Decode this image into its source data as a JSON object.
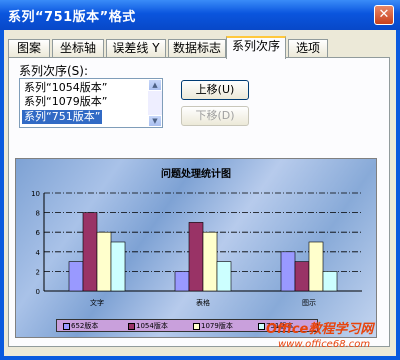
{
  "window": {
    "title": "系列“751版本”格式",
    "close_symbol": "✕"
  },
  "tabs": [
    {
      "label": "图案"
    },
    {
      "label": "坐标轴"
    },
    {
      "label": "误差线 Y"
    },
    {
      "label": "数据标志"
    },
    {
      "label": "系列次序",
      "active": true
    },
    {
      "label": "选项"
    }
  ],
  "series_order": {
    "label": "系列次序(S):",
    "items": [
      "系列“1054版本”",
      "系列“1079版本”",
      "系列“751版本”"
    ],
    "selected_index": 2
  },
  "buttons": {
    "move_up": "上移(U)",
    "move_down": "下移(D)"
  },
  "chart_data": {
    "type": "bar",
    "title": "问题处理统计图",
    "categories": [
      "文字",
      "表格",
      "图示"
    ],
    "series": [
      {
        "name": "652版本",
        "values": [
          3,
          2,
          4
        ],
        "color": "#9999ff"
      },
      {
        "name": "1054版本",
        "values": [
          8,
          7,
          3
        ],
        "color": "#993366"
      },
      {
        "name": "1079版本",
        "values": [
          6,
          6,
          5
        ],
        "color": "#ffffcc"
      },
      {
        "name": "751版本",
        "values": [
          5,
          3,
          2
        ],
        "color": "#ccffff"
      }
    ],
    "ylim": [
      0,
      10
    ],
    "yticks": [
      0,
      2,
      4,
      6,
      8,
      10
    ],
    "grid": true,
    "legend": "bottom"
  },
  "watermark": {
    "line1": "Office教程学习网",
    "line2": "www.office68.com"
  }
}
